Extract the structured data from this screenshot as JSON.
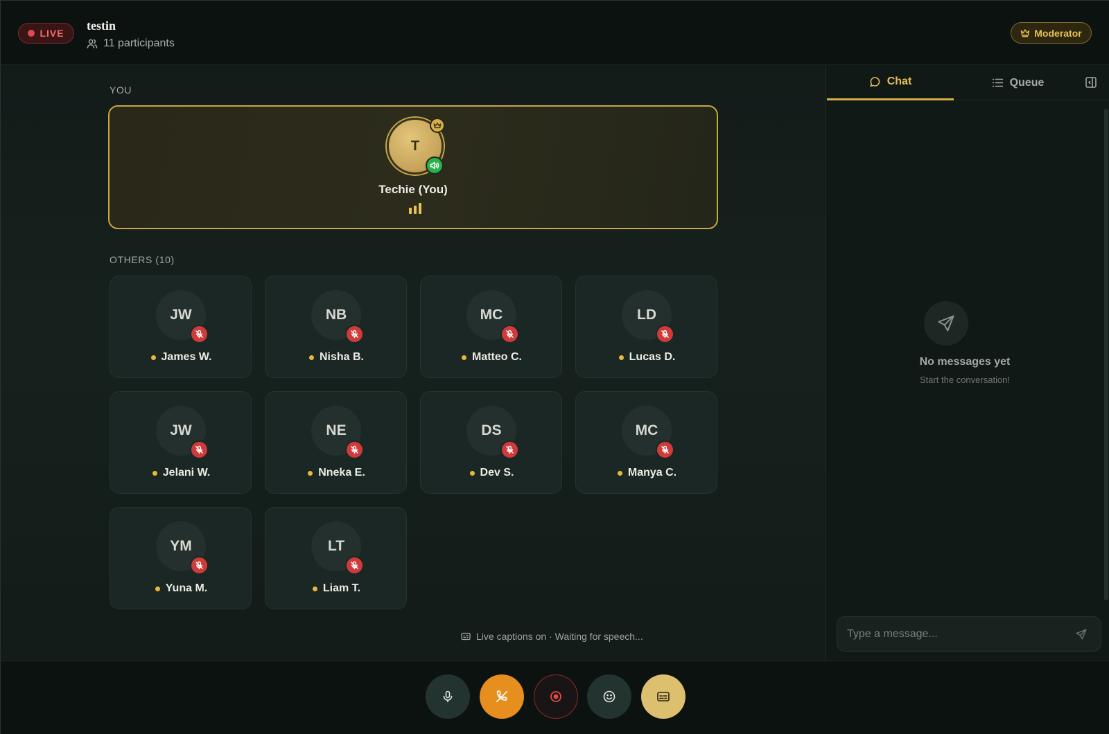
{
  "header": {
    "live_label": "LIVE",
    "room_title": "testin",
    "participants_label": "11 participants",
    "moderator_label": "Moderator"
  },
  "you_section": {
    "label": "YOU",
    "initial": "T",
    "name": "Techie (You)"
  },
  "others_section": {
    "label": "OTHERS (10)",
    "participants": [
      {
        "initials": "JW",
        "name": "James W."
      },
      {
        "initials": "NB",
        "name": "Nisha B."
      },
      {
        "initials": "MC",
        "name": "Matteo C."
      },
      {
        "initials": "LD",
        "name": "Lucas D."
      },
      {
        "initials": "JW",
        "name": "Jelani W."
      },
      {
        "initials": "NE",
        "name": "Nneka E."
      },
      {
        "initials": "DS",
        "name": "Dev S."
      },
      {
        "initials": "MC",
        "name": "Manya C."
      },
      {
        "initials": "YM",
        "name": "Yuna M."
      },
      {
        "initials": "LT",
        "name": "Liam T."
      }
    ]
  },
  "captions_status": "Live captions on · Waiting for speech...",
  "panel": {
    "tabs": [
      {
        "label": "Chat",
        "icon": "chat-bubble-icon",
        "active": true
      },
      {
        "label": "Queue",
        "icon": "list-icon",
        "active": false
      }
    ],
    "empty_title": "No messages yet",
    "empty_subtitle": "Start the conversation!",
    "input_placeholder": "Type a message..."
  },
  "controls": [
    "mic-icon",
    "leave-call-icon",
    "record-icon",
    "emoji-icon",
    "captions-icon"
  ],
  "colors": {
    "accent_gold": "#d4af45",
    "live_red": "#e04a4a",
    "mute_red": "#cf3a3a",
    "speaking_green": "#2bb04e",
    "leave_orange": "#e78f1e"
  }
}
